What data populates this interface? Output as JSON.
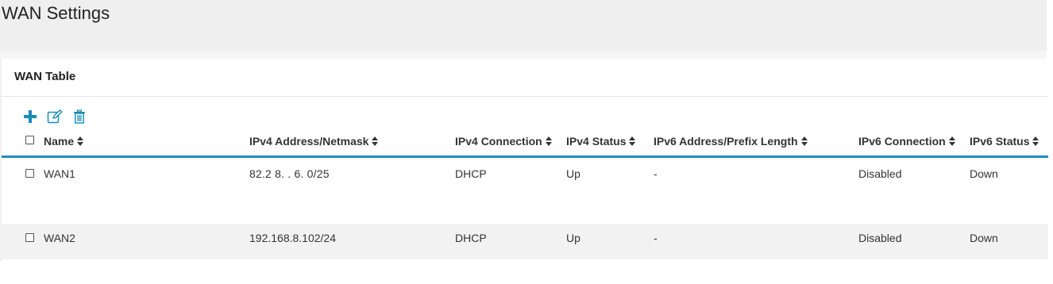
{
  "page": {
    "title": "WAN Settings"
  },
  "panel": {
    "title": "WAN Table"
  },
  "toolbar": {
    "add_icon": "plus-icon",
    "edit_icon": "edit-icon",
    "delete_icon": "trash-icon",
    "accent_color": "#1a8bb9"
  },
  "table": {
    "columns": [
      "Name",
      "IPv4 Address/Netmask",
      "IPv4 Connection",
      "IPv4 Status",
      "IPv6 Address/Prefix Length",
      "IPv6 Connection",
      "IPv6 Status"
    ],
    "rows": [
      {
        "name": "WAN1",
        "ipv4_address": "82.2  8.  .  6.  0/25",
        "ipv4_connection": "DHCP",
        "ipv4_status": "Up",
        "ipv6_address": "-",
        "ipv6_connection": "Disabled",
        "ipv6_status": "Down"
      },
      {
        "name": "WAN2",
        "ipv4_address": "192.168.8.102/24",
        "ipv4_connection": "DHCP",
        "ipv4_status": "Up",
        "ipv6_address": "-",
        "ipv6_connection": "Disabled",
        "ipv6_status": "Down"
      }
    ],
    "header_underline_color": "#1f8bc9"
  }
}
